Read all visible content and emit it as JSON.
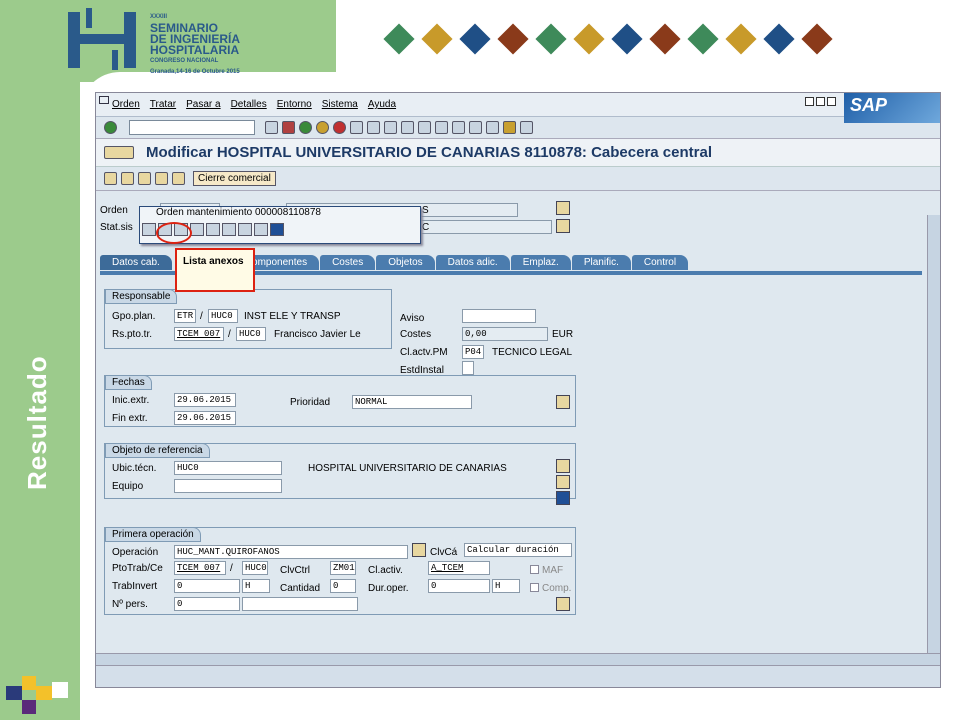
{
  "slide": {
    "side_label": "Resultado",
    "logo": {
      "number": "XXXIII",
      "line1": "SEMINARIO",
      "line2": "DE INGENIERÍA",
      "line3": "HOSPITALARIA",
      "line4": "CONGRESO NACIONAL",
      "line5": "Granada,14-16 de Octubre 2015"
    },
    "diamond_colors": [
      "#3e8a5a",
      "#c89a2a",
      "#1f4f86",
      "#8a3a1a",
      "#3e8a5a",
      "#c89a2a",
      "#1f4f86",
      "#8a3a1a",
      "#3e8a5a",
      "#c89a2a",
      "#1f4f86",
      "#8a3a1a"
    ]
  },
  "sap": {
    "menu": [
      "Orden",
      "Tratar",
      "Pasar a",
      "Detalles",
      "Entorno",
      "Sistema",
      "Ayuda"
    ],
    "brand": "SAP",
    "title": "Modificar HOSPITAL UNIVERSITARIO DE CANARIAS 8110878: Cabecera central",
    "app_button": "Cierre comercial",
    "header_labels": {
      "orden": "Orden",
      "stat": "Stat.sis"
    },
    "header_values": {
      "orden_suffix": "S",
      "stat_suffix": "C"
    },
    "popup": {
      "title": "Orden mantenimiento 000008110878"
    },
    "tooltip": "Lista anexos",
    "tabs": [
      "Datos cab.",
      "Componentes",
      "Costes",
      "Objetos",
      "Datos adic.",
      "Emplaz.",
      "Planific.",
      "Control"
    ],
    "responsable": {
      "title": "Responsable",
      "gpo_label": "Gpo.plan.",
      "gpo_value": "ETR",
      "gpo_center": "HUC0",
      "gpo_text": "INST ELE Y TRANSP",
      "rs_label": "Rs.pto.tr.",
      "rs_value": "TCEM 007",
      "rs_center": "HUC0",
      "rs_text": "Francisco Javier Le",
      "slash": "/"
    },
    "right": {
      "aviso_label": "Aviso",
      "costes_label": "Costes",
      "costes_value": "0,00",
      "currency": "EUR",
      "clactv_label": "Cl.actv.PM",
      "clactv_value": "P04",
      "clactv_text": "TECNICO LEGAL",
      "estd_label": "EstdInstal"
    },
    "fechas": {
      "title": "Fechas",
      "inic_label": "Inic.extr.",
      "inic_value": "29.06.2015",
      "fin_label": "Fin extr.",
      "fin_value": "29.06.2015",
      "prio_label": "Prioridad",
      "prio_value": "NORMAL"
    },
    "objeto": {
      "title": "Objeto de referencia",
      "ubic_label": "Ubic.técn.",
      "ubic_value": "HUC0",
      "ubic_text": "HOSPITAL UNIVERSITARIO DE CANARIAS",
      "equipo_label": "Equipo"
    },
    "operacion": {
      "title": "Primera operación",
      "op_label": "Operación",
      "op_value": "HUC_MANT.QUIROFANOS",
      "clvca_label": "ClvCá",
      "clvca_value": "Calcular duración",
      "pto_label": "PtoTrab/Ce",
      "pto_value": "TCEM 007",
      "pto_center": "HUC0",
      "clvctrl_label": "ClvCtrl",
      "clvctrl_value": "ZM01",
      "clactiv_label": "Cl.activ.",
      "clactiv_value": "A_TCEM",
      "maf_label": "MAF",
      "trab_label": "TrabInvert",
      "trab_value": "0",
      "trab_unit": "H",
      "cant_label": "Cantidad",
      "cant_value": "0",
      "dur_label": "Dur.oper.",
      "dur_value": "0",
      "dur_unit": "H",
      "comp_label": "Comp.",
      "npers_label": "Nº pers.",
      "npers_value": "0"
    }
  }
}
